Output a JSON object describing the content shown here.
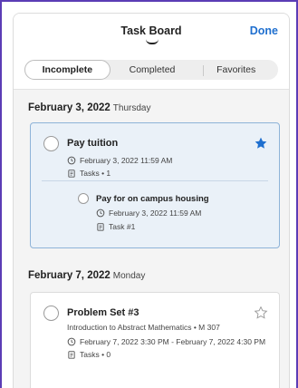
{
  "header": {
    "title": "Task Board",
    "done_label": "Done"
  },
  "tabs": [
    {
      "label": "Incomplete",
      "active": true
    },
    {
      "label": "Completed",
      "active": false
    },
    {
      "label": "Favorites",
      "active": false
    }
  ],
  "groups": [
    {
      "date": "February 3, 2022",
      "weekday": "Thursday",
      "task": {
        "title": "Pay tuition",
        "due": "February 3, 2022 11:59 AM",
        "tasks": "Tasks • 1",
        "favorite": true,
        "subtask": {
          "title": "Pay for on campus housing",
          "due": "February 3, 2022 11:59 AM",
          "tasks": "Task #1"
        }
      }
    },
    {
      "date": "February 7, 2022",
      "weekday": "Monday",
      "task": {
        "title": "Problem Set #3",
        "course": "Introduction to Abstract Mathematics • M 307",
        "due": "February 7, 2022 3:30 PM - February 7, 2022 4:30 PM",
        "tasks": "Tasks • 0",
        "favorite": false
      }
    }
  ],
  "colors": {
    "accent": "#1f6fcf",
    "selected_card_bg": "#eaf1f8",
    "selected_card_border": "#8eb3d8",
    "frame": "#5b3db5"
  },
  "icons": {
    "clock": "clock-icon",
    "clipboard": "clipboard-icon",
    "star_filled": "star-filled-icon",
    "star_outline": "star-outline-icon"
  }
}
